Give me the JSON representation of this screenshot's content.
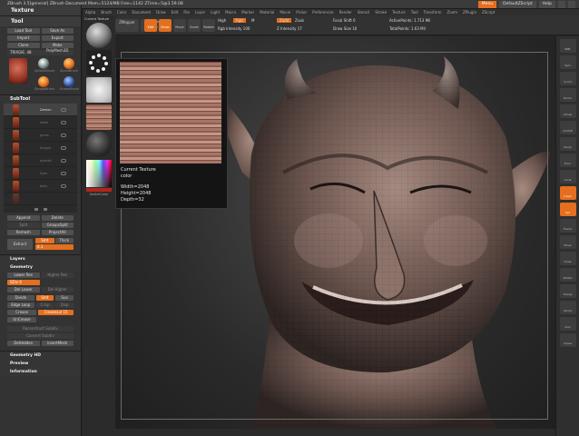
{
  "titlebar": {
    "title": "ZBrush  3.5[general]   ZBrush Document   Mem=5124/MB  Free=1142  ZTime=5@3.59.08",
    "menu_label": "Menu",
    "script_label": "DefaultZScript",
    "help_label": "Help"
  },
  "menubar": {
    "items": [
      "Alpha",
      "Brush",
      "Color",
      "Document",
      "Draw",
      "Edit",
      "File",
      "Layer",
      "Light",
      "Macro",
      "Marker",
      "Material",
      "Movie",
      "Picker",
      "Preferences",
      "Render",
      "Stencil",
      "Stroke",
      "Texture",
      "Tool",
      "Transform",
      "Zoom",
      "ZPlugin",
      "ZScript"
    ]
  },
  "left_palette": {
    "title": "Texture",
    "tool_title": "Tool",
    "load_tool": "Load Tool",
    "save_as": "Save As",
    "import": "Import",
    "export": "Export",
    "clone": "Clone",
    "make_polymesh": "Make PolyMesh3D",
    "tool_name": "TRIXGIE. 48",
    "tool_labels": [
      "SphereBrush",
      "AlphaBrush",
      "SimpleBrush",
      "EraserBrush"
    ],
    "subtool_title": "SubTool",
    "subtool_labels": [
      "Demon",
      "teeth",
      "gums",
      "tongue",
      "eyeball",
      "Eyes",
      "belly"
    ],
    "append": "Append",
    "delete": "Delete",
    "split": "Split",
    "merge": "MergeDown",
    "groups_split": "GroupsSplit",
    "remesh": "Remesh",
    "project_all": "ProjectAll",
    "extract": "Extract",
    "smt": "Smt",
    "thick": "Thick",
    "thick_value": "0.1",
    "layers": "Layers",
    "geometry": "Geometry",
    "lower_res": "Lower Res",
    "higher_res": "Higher Res",
    "sdiv": "SDiv 6",
    "del_lower": "Del Lower",
    "del_higher": "Del Higher",
    "divide": "Divide",
    "smt_btn": "Smt",
    "suv": "Suv",
    "edge_loop": "Edge Loop",
    "crisp": "Crisp",
    "disp": "Disp",
    "crease": "Crease",
    "crease_lvl": "CreaseLvl 15",
    "uncrease": "UnCrease",
    "reconstruct": "Reconstruct Subdiv",
    "convert": "Convert Subdiv",
    "del_hidden": "DelHidden",
    "insert_mesh": "InsertMesh",
    "geometry_hd": "Geometry HD",
    "preview": "Preview",
    "information": "Information"
  },
  "top_shelf": {
    "zmapper": "ZMapper",
    "projection_master": "Projection Master",
    "edit": "Edit",
    "draw": "Draw",
    "move": "Move",
    "scale": "Scale",
    "rotate": "Rotate",
    "high": "High",
    "rgb": "Rgb",
    "rgb_intensity": "Rgb Intensity 100",
    "m": "M",
    "zadd": "Zadd",
    "zsub": "Zsub",
    "z_intensity": "Z Intensity 17",
    "focal_shift": "Focal Shift 0",
    "draw_size": "Draw Size 16",
    "active_points": "ActivePoints: 1.713 Mil",
    "total_points": "TotalPoints: 1.63 Mil"
  },
  "shelf": {
    "label": "Current Texture",
    "switch_color": "SwitchColor"
  },
  "texture_popup": {
    "line1": "Current Texture",
    "line2": "color",
    "width": "Width=2048",
    "height": "Height=2048",
    "depth": "Depth=32"
  },
  "right_shelf": {
    "items": [
      "BPR",
      "Spix",
      "Scroll",
      "Zoom",
      "Actual",
      "AAHalf",
      "Persp",
      "Floor",
      "Local",
      "L.Sym",
      "Xyz",
      "Frame",
      "Move",
      "Scale",
      "Rotate",
      "Transp",
      "Ghost",
      "Solo",
      "Xpose"
    ]
  },
  "colors": {
    "accent": "#e36f1f",
    "background": "#262626",
    "panel": "#333333"
  }
}
